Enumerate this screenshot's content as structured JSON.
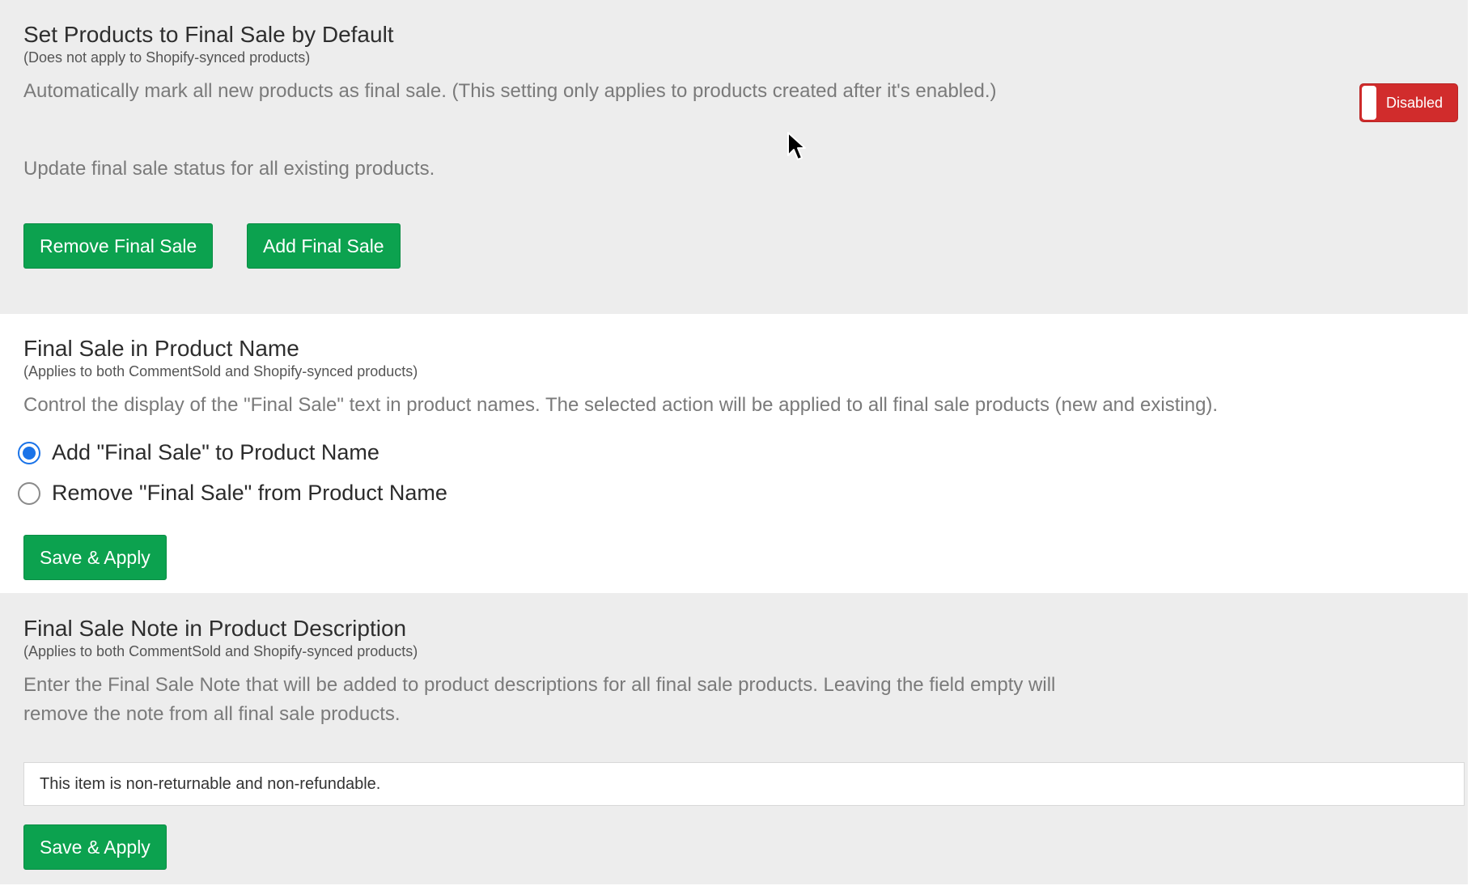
{
  "default_section": {
    "title": "Set Products to Final Sale by Default",
    "subtitle": "(Does not apply to Shopify-synced products)",
    "description": "Automatically mark all new products as final sale. (This setting only applies to products created after it's enabled.)",
    "toggle_label": "Disabled",
    "toggle_state": "off",
    "toggle_color": "#d12c2c",
    "update_text": "Update final sale status for all existing products.",
    "remove_button": "Remove Final Sale",
    "add_button": "Add Final Sale"
  },
  "name_section": {
    "title": "Final Sale in Product Name",
    "subtitle": "(Applies to both CommentSold and Shopify-synced products)",
    "description": "Control the display of the \"Final Sale\" text in product names. The selected action will be applied to all final sale products (new and existing).",
    "options": [
      {
        "label": "Add \"Final Sale\" to Product Name",
        "checked": true
      },
      {
        "label": "Remove \"Final Sale\" from Product Name",
        "checked": false
      }
    ],
    "save_button": "Save & Apply"
  },
  "note_section": {
    "title": "Final Sale Note in Product Description",
    "subtitle": "(Applies to both CommentSold and Shopify-synced products)",
    "description_line1": "Enter the Final Sale Note that will be added to product descriptions for all final sale products. Leaving the field empty will",
    "description_line2": "remove the note from all final sale products.",
    "note_value": "This item is non-returnable and non-refundable.",
    "save_button": "Save & Apply"
  },
  "colors": {
    "accent_green": "#0ca24f",
    "radio_blue": "#1a73e8",
    "section_gray": "#ededed"
  },
  "icons": {
    "cursor": "mouse-pointer-icon"
  }
}
